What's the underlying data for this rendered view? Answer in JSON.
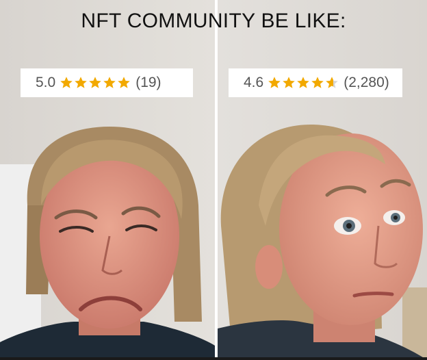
{
  "caption": "NFT COMMUNITY BE LIKE:",
  "panels": [
    {
      "score": "5.0",
      "rating": 5,
      "count": "(19)",
      "expression": "disgusted"
    },
    {
      "score": "4.6",
      "rating": 4.6,
      "count": "(2,280)",
      "expression": "intrigued"
    }
  ],
  "colors": {
    "star": "#f2a900",
    "star_empty": "#d6d6d6",
    "rating_text": "#555555",
    "caption": "#111111"
  }
}
